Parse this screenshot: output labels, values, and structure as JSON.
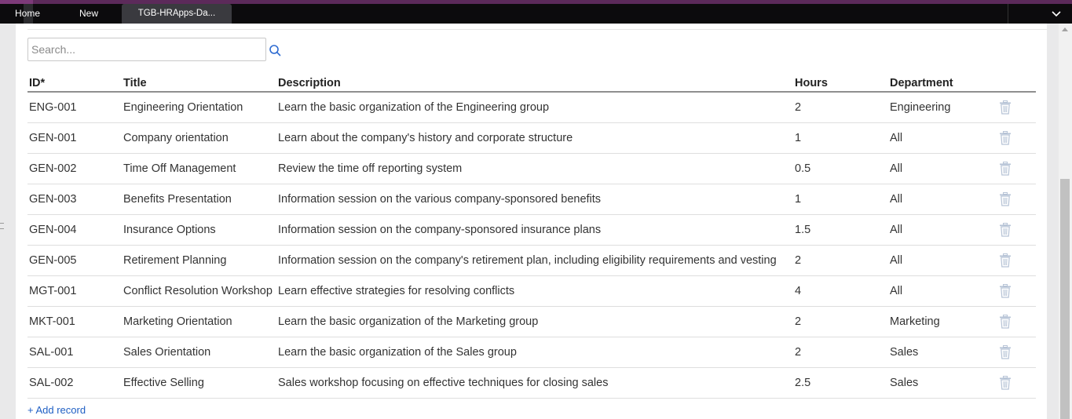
{
  "tabs": [
    {
      "label": "Home"
    },
    {
      "label": "New"
    },
    {
      "label": "TGB-HRApps-Da..."
    }
  ],
  "search": {
    "placeholder": "Search...",
    "value": ""
  },
  "table": {
    "headers": {
      "id": "ID*",
      "title": "Title",
      "description": "Description",
      "hours": "Hours",
      "department": "Department"
    },
    "rows": [
      {
        "id": "ENG-001",
        "title": "Engineering Orientation",
        "description": "Learn the basic organization of the Engineering group",
        "hours": "2",
        "department": "Engineering"
      },
      {
        "id": "GEN-001",
        "title": "Company orientation",
        "description": "Learn about the company's history and corporate structure",
        "hours": "1",
        "department": "All"
      },
      {
        "id": "GEN-002",
        "title": "Time Off Management",
        "description": "Review the time off reporting system",
        "hours": "0.5",
        "department": "All"
      },
      {
        "id": "GEN-003",
        "title": "Benefits Presentation",
        "description": "Information session on the various company-sponsored benefits",
        "hours": "1",
        "department": "All"
      },
      {
        "id": "GEN-004",
        "title": "Insurance Options",
        "description": "Information session on the company-sponsored insurance plans",
        "hours": "1.5",
        "department": "All"
      },
      {
        "id": "GEN-005",
        "title": "Retirement Planning",
        "description": "Information session on the company's retirement plan, including eligibility requirements and vesting",
        "hours": "2",
        "department": "All"
      },
      {
        "id": "MGT-001",
        "title": "Conflict Resolution Workshop",
        "description": "Learn effective strategies for resolving conflicts",
        "hours": "4",
        "department": "All"
      },
      {
        "id": "MKT-001",
        "title": "Marketing Orientation",
        "description": "Learn the basic organization of the Marketing group",
        "hours": "2",
        "department": "Marketing"
      },
      {
        "id": "SAL-001",
        "title": "Sales Orientation",
        "description": "Learn the basic organization of the Sales group",
        "hours": "2",
        "department": "Sales"
      },
      {
        "id": "SAL-002",
        "title": "Effective Selling",
        "description": "Sales workshop focusing on effective techniques for closing sales",
        "hours": "2.5",
        "department": "Sales"
      }
    ]
  },
  "add_record_label": "+ Add record",
  "icons": {
    "search": "search-icon",
    "delete": "trash-icon",
    "menu": "chevron-down-icon"
  },
  "colors": {
    "accent": "#7d3a79",
    "link": "#1f5fc4",
    "tabbar": "#0c0b0d",
    "trash": "#b6c3d6"
  }
}
